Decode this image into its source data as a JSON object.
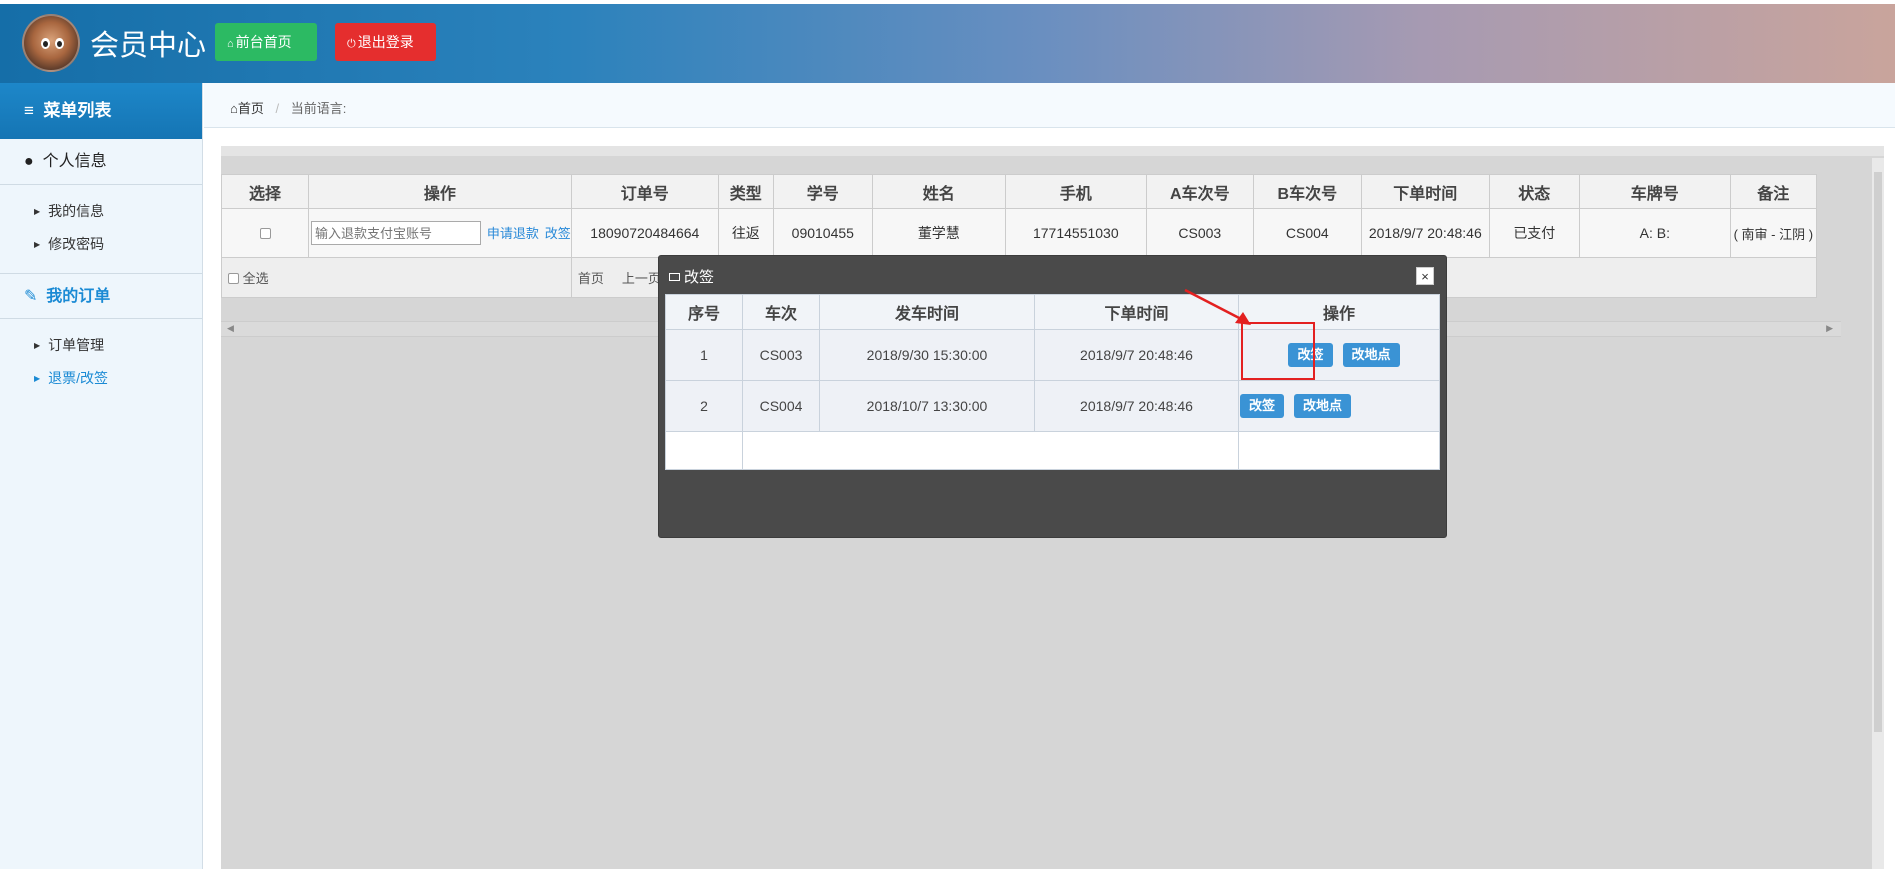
{
  "header": {
    "brand": "会员中心",
    "home_button": "前台首页",
    "logout_button": "退出登录"
  },
  "sidebar": {
    "menu_title": "菜单列表",
    "personal": {
      "title": "个人信息",
      "items": [
        "我的信息",
        "修改密码"
      ]
    },
    "orders": {
      "title": "我的订单",
      "items": [
        "订单管理",
        "退票/改签"
      ]
    }
  },
  "breadcrumb": {
    "home": "首页",
    "current_language": "当前语言:"
  },
  "orders_table": {
    "columns": [
      "选择",
      "操作",
      "订单号",
      "类型",
      "学号",
      "姓名",
      "手机",
      "A车次号",
      "B车次号",
      "下单时间",
      "状态",
      "车牌号",
      "备注"
    ],
    "row": {
      "refund_placeholder": "输入退款支付宝账号",
      "refund_link": "申请退款",
      "change_link": "改签",
      "order_no": "18090720484664",
      "type": "往返",
      "student_no": "09010455",
      "name": "董学慧",
      "phone": "17714551030",
      "train_a": "CS003",
      "train_b": "CS004",
      "order_time": "2018/9/7 20:48:46",
      "status": "已支付",
      "plate": "A: B:",
      "remark": "( 南审 - 江阴 )"
    },
    "footer": {
      "select_all": "全选",
      "first_page": "首页",
      "prev_page": "上一页"
    }
  },
  "modal": {
    "title": "改签",
    "close": "×",
    "columns": [
      "序号",
      "车次",
      "发车时间",
      "下单时间",
      "操作"
    ],
    "rows": [
      {
        "index": "1",
        "train": "CS003",
        "depart": "2018/9/30 15:30:00",
        "order_time": "2018/9/7 20:48:46"
      },
      {
        "index": "2",
        "train": "CS004",
        "depart": "2018/10/7 13:30:00",
        "order_time": "2018/9/7 20:48:46"
      }
    ],
    "change_button": "改签",
    "change_place_button": "改地点"
  },
  "colors": {
    "accent_blue": "#1a8ad4",
    "home_green": "#2cba63",
    "logout_red": "#e52e2e",
    "modal_bg": "#4a4a4a"
  }
}
